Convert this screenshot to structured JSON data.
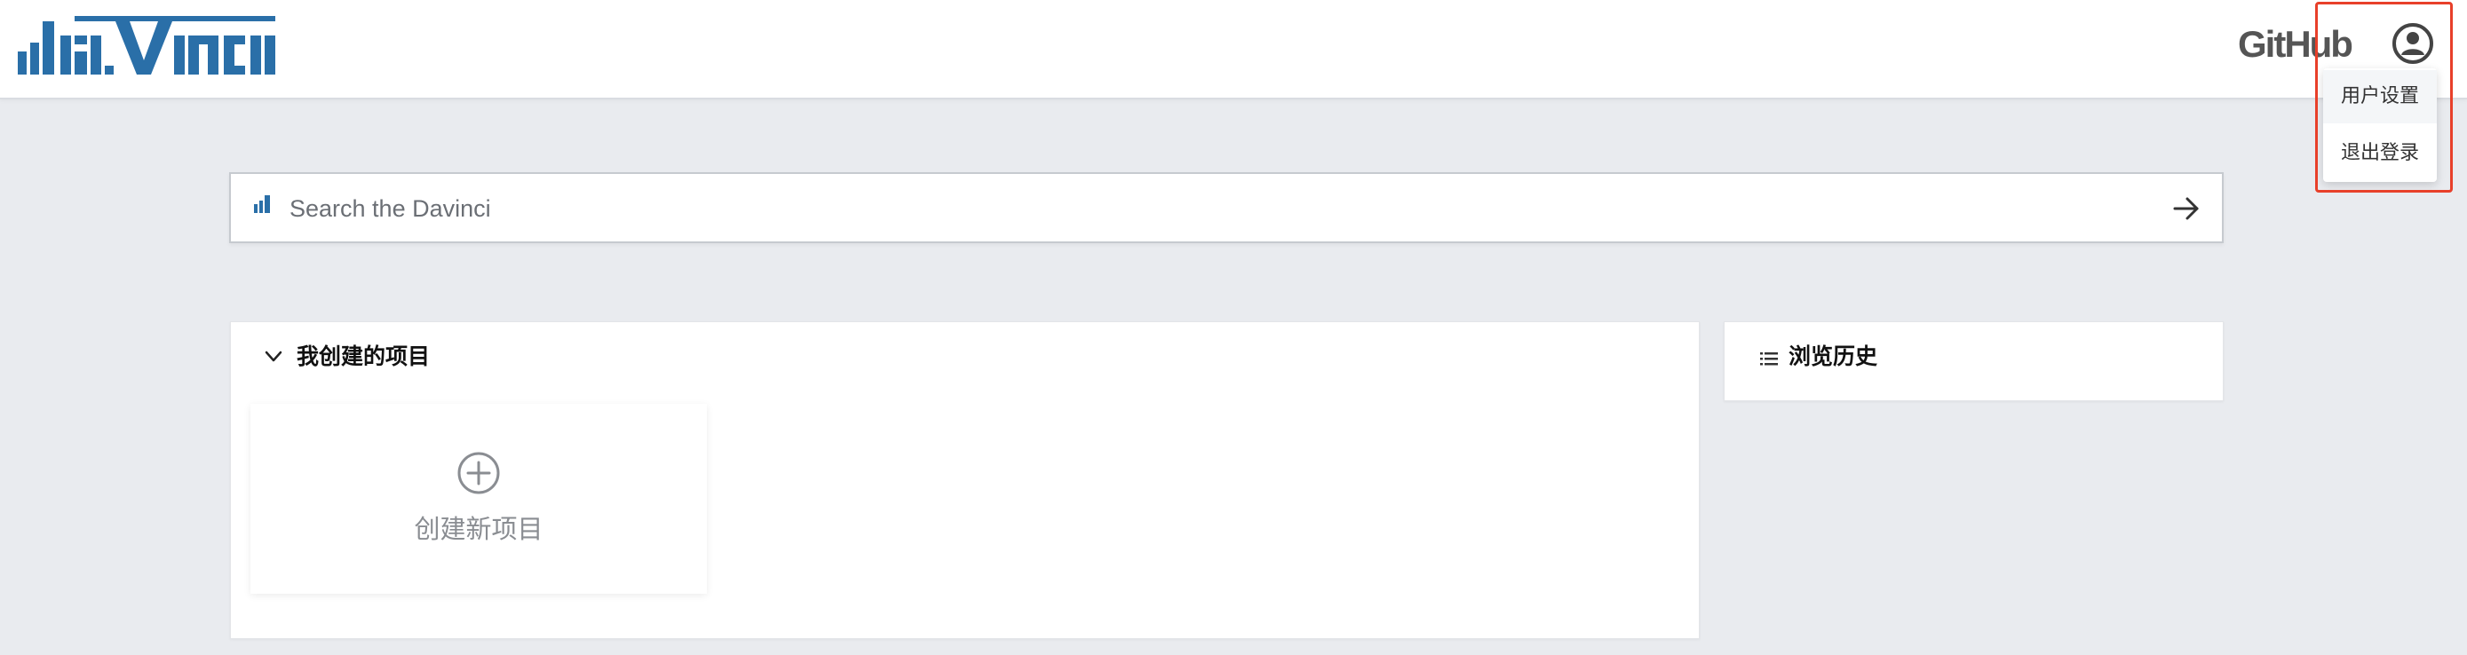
{
  "header": {
    "github_label": "GitHub",
    "avatar_icon": "user-circle-icon"
  },
  "user_menu": {
    "items": [
      {
        "label": "用户设置"
      },
      {
        "label": "退出登录"
      }
    ],
    "highlight_color": "#e8402a"
  },
  "search": {
    "placeholder": "Search the Davinci",
    "value": "",
    "submit_icon": "arrow-right-icon"
  },
  "projects_panel": {
    "title": "我创建的项目",
    "toggle_icon": "chevron-down-icon",
    "create_label": "创建新项目",
    "create_icon": "plus-circle-icon"
  },
  "history_panel": {
    "title": "浏览历史",
    "icon": "list-icon"
  },
  "colors": {
    "brand": "#2a6fa8",
    "background": "#e9ebef",
    "panel": "#ffffff"
  }
}
